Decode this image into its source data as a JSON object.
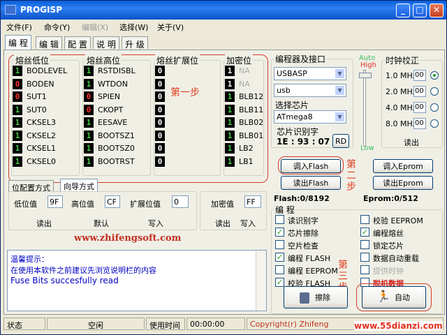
{
  "title": "PROGISP",
  "menu": [
    {
      "label": "文件(F)",
      "disabled": false
    },
    {
      "label": "命令(Y)",
      "disabled": false
    },
    {
      "label": "编辑(X)",
      "disabled": true
    },
    {
      "label": "选择(W)",
      "disabled": false
    },
    {
      "label": "关于(V)",
      "disabled": false
    }
  ],
  "tabs": [
    "编 程",
    "编 辑",
    "配 置",
    "说 明",
    "升 级"
  ],
  "groups": {
    "low": "熔丝低位",
    "high": "熔丝高位",
    "ext": "熔丝扩展位",
    "lock": "加密位"
  },
  "fuses_low": [
    {
      "bit": "1",
      "color": "g",
      "name": "BODLEVEL"
    },
    {
      "bit": "0",
      "color": "r",
      "name": "BODEN"
    },
    {
      "bit": "0",
      "color": "r",
      "name": "SUT1"
    },
    {
      "bit": "1",
      "color": "g",
      "name": "SUT0"
    },
    {
      "bit": "1",
      "color": "g",
      "name": "CKSEL3"
    },
    {
      "bit": "1",
      "color": "g",
      "name": "CKSEL2"
    },
    {
      "bit": "1",
      "color": "g",
      "name": "CKSEL1"
    },
    {
      "bit": "1",
      "color": "g",
      "name": "CKSEL0"
    }
  ],
  "fuses_high": [
    {
      "bit": "1",
      "color": "g",
      "name": "RSTDISBL"
    },
    {
      "bit": "1",
      "color": "g",
      "name": "WTDON"
    },
    {
      "bit": "0",
      "color": "r",
      "name": "SPIEN"
    },
    {
      "bit": "0",
      "color": "r",
      "name": "CKOPT"
    },
    {
      "bit": "1",
      "color": "g",
      "name": "EESAVE"
    },
    {
      "bit": "1",
      "color": "g",
      "name": "BOOTSZ1"
    },
    {
      "bit": "1",
      "color": "g",
      "name": "BOOTSZ0"
    },
    {
      "bit": "1",
      "color": "g",
      "name": "BOOTRST"
    }
  ],
  "fuses_ext": [
    "0",
    "0",
    "0",
    "0",
    "0",
    "0",
    "0",
    "0"
  ],
  "fuses_lock": [
    {
      "bit": "1",
      "color": "w",
      "name": "NA",
      "dis": true
    },
    {
      "bit": "1",
      "color": "w",
      "name": "NA",
      "dis": true
    },
    {
      "bit": "1",
      "color": "g",
      "name": "BLB12",
      "dis": false
    },
    {
      "bit": "1",
      "color": "g",
      "name": "BLB11",
      "dis": false
    },
    {
      "bit": "1",
      "color": "g",
      "name": "BLB02",
      "dis": false
    },
    {
      "bit": "1",
      "color": "g",
      "name": "BLB01",
      "dis": false
    },
    {
      "bit": "1",
      "color": "g",
      "name": "LB2",
      "dis": false
    },
    {
      "bit": "1",
      "color": "g",
      "name": "LB1",
      "dis": false
    }
  ],
  "step1": "第一步",
  "step2": "第二步",
  "step3": "第三步",
  "subtabs": [
    "位配置方式",
    "向导方式"
  ],
  "values": {
    "low_label": "低位值",
    "low": "9F",
    "high_label": "高位值",
    "high": "CF",
    "ext_label": "扩展位值",
    "ext": "0",
    "lock_label": "加密值",
    "lock": "FF"
  },
  "buttons": {
    "read": "读出",
    "default": "默认",
    "write": "写入",
    "read2": "读出",
    "write2": "写入",
    "load_flash": "调入Flash",
    "load_eprom": "调入Eprom",
    "read_flash": "读出Flash",
    "read_eprom": "读出Eprom",
    "erase": "擦除",
    "auto": "自动",
    "readchip": "读出",
    "rd": "RD"
  },
  "website": "www.zhifengsoft.com",
  "tips": {
    "title": "温馨提示：",
    "line1": "在使用本软件之前建议先浏览说明栏的内容",
    "line2": "Fuse Bits succesfully read"
  },
  "programmer": {
    "label": "编程器及接口",
    "device": "USBASP",
    "port": "usb",
    "chip_label": "选择芯片",
    "chip": "ATmega8",
    "sig_label": "芯片识别字",
    "sig": "1E : 93 : 07"
  },
  "speed": {
    "auto": "Auto",
    "high": "High",
    "low": "Low"
  },
  "clock": {
    "label": "时钟校正",
    "rows": [
      {
        "mhz": "1.0 MHz",
        "val": "00",
        "on": true
      },
      {
        "mhz": "2.0 MHz",
        "val": "00",
        "on": false
      },
      {
        "mhz": "4.0 MHz",
        "val": "00",
        "on": false
      },
      {
        "mhz": "8.0 MHz",
        "val": "00",
        "on": false
      }
    ]
  },
  "flash_info": "Flash:0/8192",
  "eprom_info": "Eprom:0/512",
  "prog": {
    "label": "编 程",
    "left": [
      {
        "t": "读识别字",
        "c": false
      },
      {
        "t": "芯片擦除",
        "c": true
      },
      {
        "t": "空片检查",
        "c": false
      },
      {
        "t": "编程 FLASH",
        "c": true
      },
      {
        "t": "编程 EEPROM",
        "c": false
      },
      {
        "t": "校验 FLASH",
        "c": true
      }
    ],
    "right": [
      {
        "t": "校验 EEPROM",
        "c": false,
        "style": ""
      },
      {
        "t": "编程熔丝",
        "c": true,
        "style": ""
      },
      {
        "t": "锁定芯片",
        "c": false,
        "style": ""
      },
      {
        "t": "数据自动重载",
        "c": false,
        "style": ""
      },
      {
        "t": "提供时钟",
        "c": false,
        "style": "dis"
      },
      {
        "t": "脱机数据",
        "c": false,
        "style": "red"
      }
    ]
  },
  "status": {
    "state": "状态",
    "idle": "空闲",
    "time_label": "使用时间",
    "time": "00:00:00",
    "copyright": "Copyright(r) Zhifeng",
    "watermark": "www.55dianzi.com"
  },
  "colors": {
    "accent": "#0a5fd8",
    "annot": "#d03c28",
    "site": "#c03020"
  }
}
